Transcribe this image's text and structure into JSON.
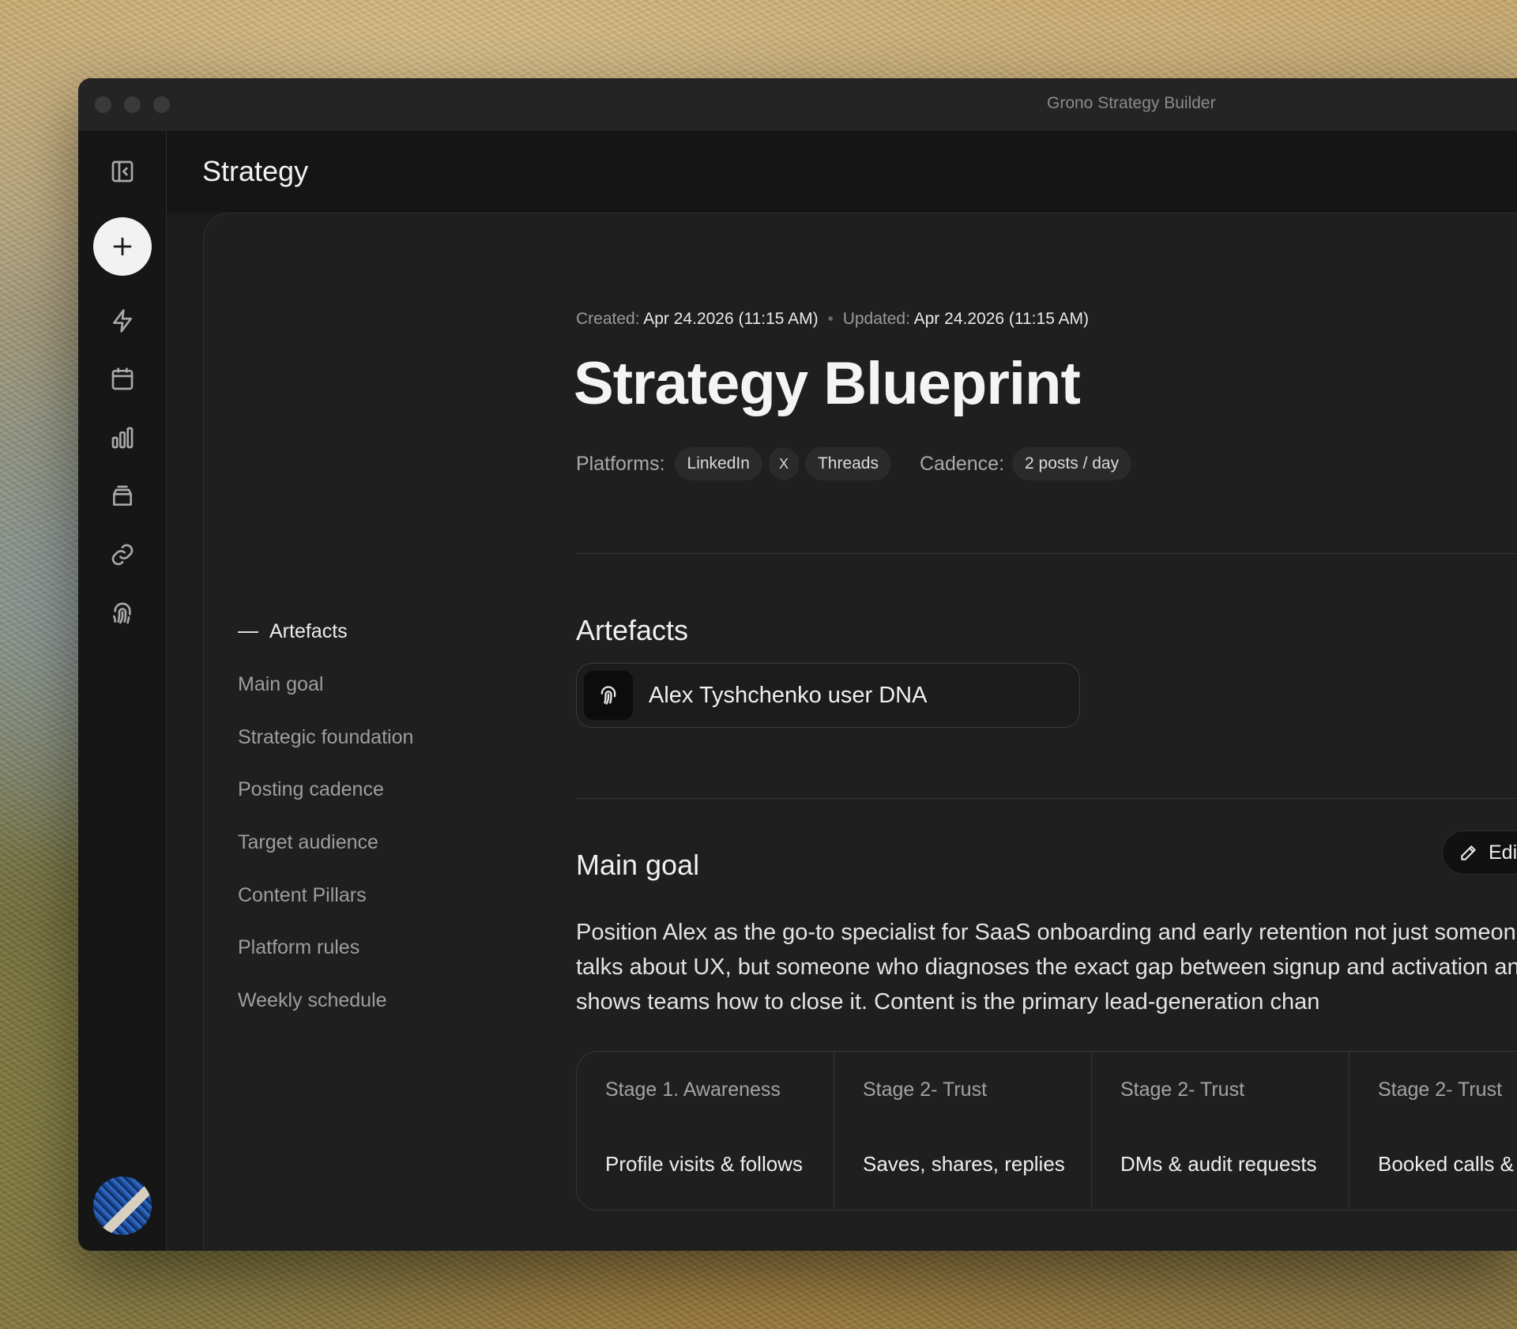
{
  "window": {
    "title": "Grono Strategy Builder"
  },
  "header": {
    "title": "Strategy"
  },
  "sidebar": {
    "icons": [
      "collapse-sidebar-icon",
      "plus-icon",
      "lightning-icon",
      "calendar-icon",
      "bar-chart-icon",
      "inbox-icon",
      "link-icon",
      "fingerprint-icon"
    ]
  },
  "doc": {
    "created_label": "Created:",
    "created_value": "Apr 24.2026 (11:15 AM)",
    "updated_label": "Updated:",
    "updated_value": "Apr 24.2026 (11:15 AM)",
    "title": "Strategy Blueprint",
    "platforms_label": "Platforms:",
    "platforms": [
      "LinkedIn",
      "X",
      "Threads"
    ],
    "cadence_label": "Cadence:",
    "cadence_value": "2 posts / day"
  },
  "toc": [
    "Artefacts",
    "Main goal",
    "Strategic foundation",
    "Posting cadence",
    "Target audience",
    "Content Pillars",
    "Platform rules",
    "Weekly schedule"
  ],
  "artefacts": {
    "title": "Artefacts",
    "items": [
      {
        "label": "Alex Tyshchenko user DNA"
      }
    ]
  },
  "main_goal": {
    "title": "Main goal",
    "edit_label": "Edit",
    "text": "Position Alex as the go-to specialist for SaaS onboarding and early retention not just someone who talks about UX, but someone who diagnoses the exact gap between signup and activation and shows teams how to close it. Content is the primary lead-generation chan",
    "stages": [
      {
        "label": "Stage 1. Awareness",
        "value": "Profile visits & follows"
      },
      {
        "label": "Stage 2- Trust",
        "value": "Saves, shares, replies"
      },
      {
        "label": "Stage 2- Trust",
        "value": "DMs & audit requests"
      },
      {
        "label": "Stage 2- Trust",
        "value": "Booked calls & clients"
      }
    ]
  }
}
